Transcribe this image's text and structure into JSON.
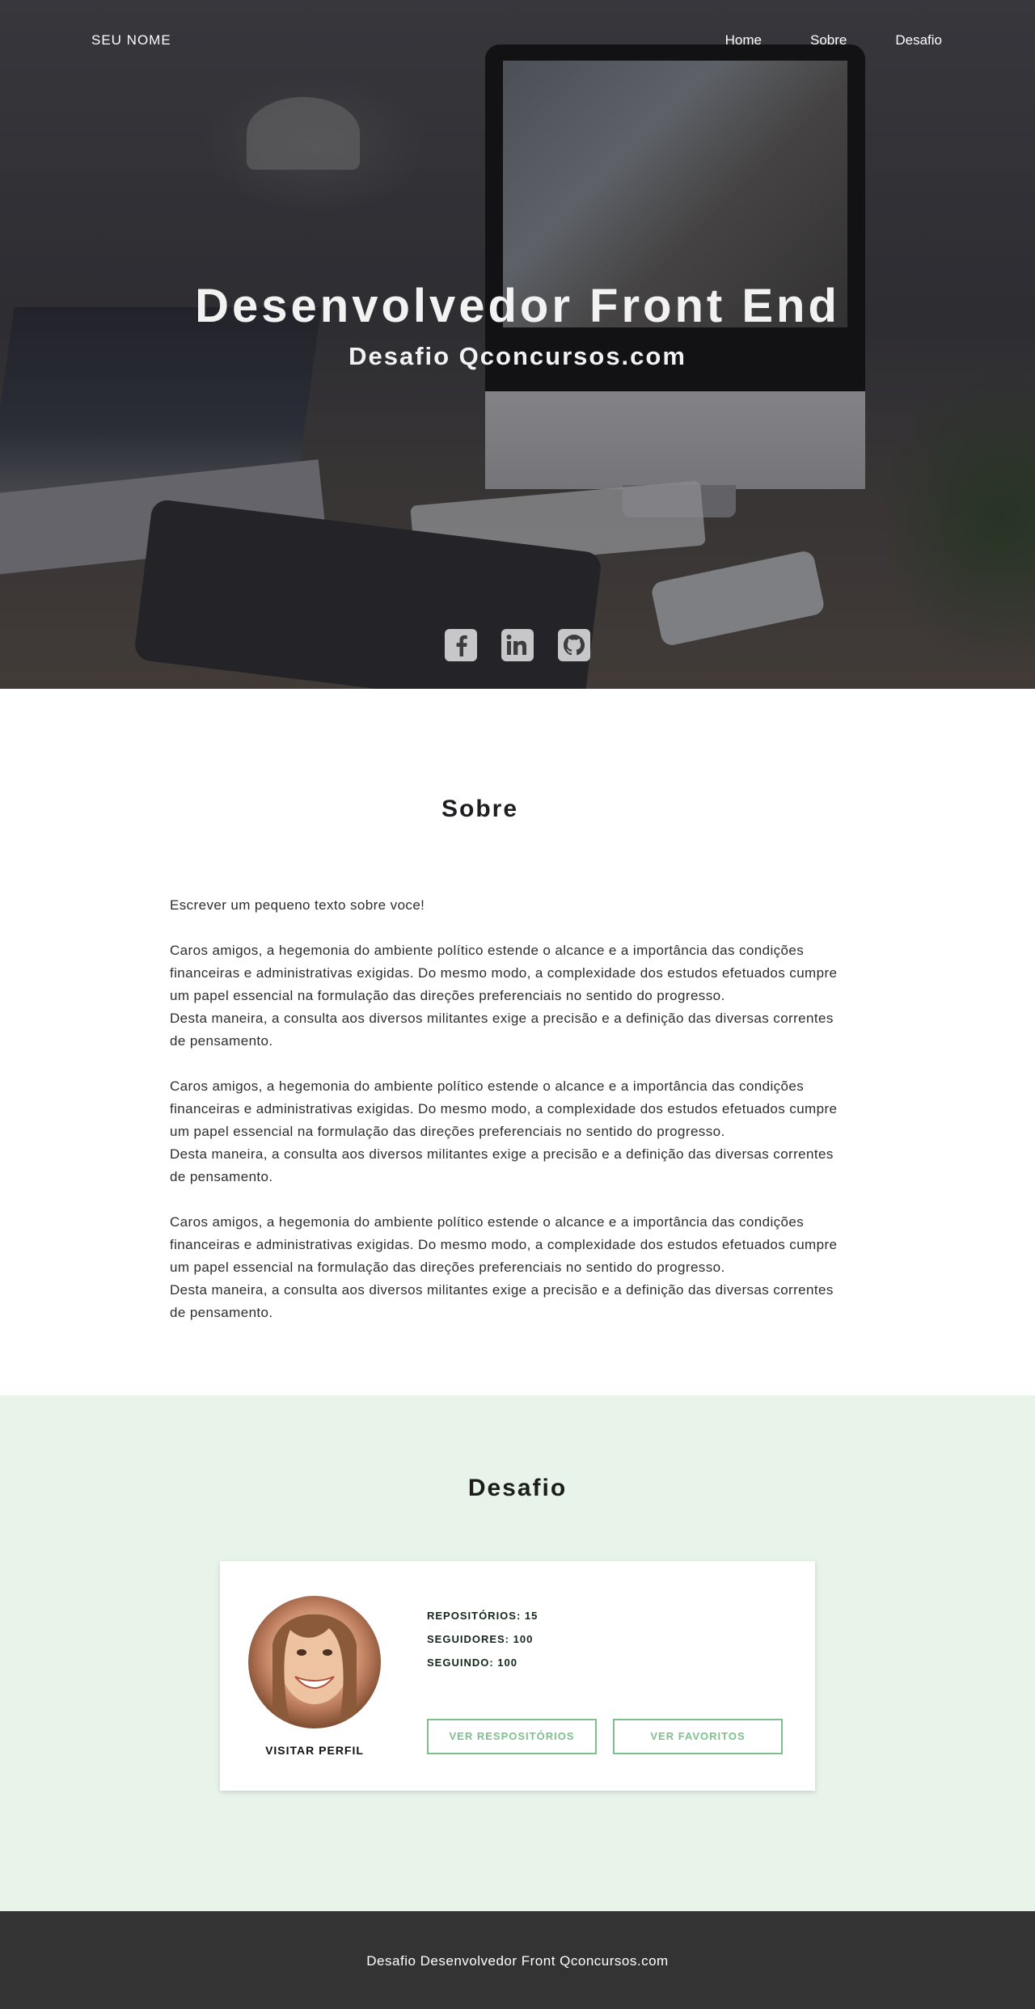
{
  "nav": {
    "brand": "SEU NOME",
    "links": [
      "Home",
      "Sobre",
      "Desafio"
    ]
  },
  "hero": {
    "title": "Desenvolvedor Front End",
    "subtitle": "Desafio Qconcursos.com",
    "social_icons": [
      "facebook-icon",
      "linkedin-icon",
      "github-icon"
    ]
  },
  "sobre": {
    "title": "Sobre",
    "intro": "Escrever um pequeno texto sobre voce!",
    "paragraphs": [
      [
        "Caros amigos, a hegemonia do ambiente político estende o alcance e a importância das condições",
        "financeiras e administrativas exigidas. Do mesmo modo, a complexidade dos estudos efetuados cumpre",
        "um papel essencial na formulação das direções preferenciais no sentido do progresso.",
        "Desta maneira, a consulta aos diversos militantes exige a precisão e a definição das diversas correntes",
        "de pensamento."
      ],
      [
        "Caros amigos, a hegemonia do ambiente político estende o alcance e a importância das condições",
        "financeiras e administrativas exigidas. Do mesmo modo, a complexidade dos estudos efetuados cumpre",
        "um papel essencial na formulação das direções preferenciais no sentido do progresso.",
        "Desta maneira, a consulta aos diversos militantes exige a precisão e a definição das diversas correntes",
        "de pensamento."
      ],
      [
        "Caros amigos, a hegemonia do ambiente político estende o alcance e a importância das condições",
        "financeiras e administrativas exigidas. Do mesmo modo, a complexidade dos estudos efetuados cumpre",
        "um papel essencial na formulação das direções preferenciais no sentido do progresso.",
        "Desta maneira, a consulta aos diversos militantes exige a precisão e a definição das diversas correntes",
        "de pensamento."
      ]
    ]
  },
  "desafio": {
    "title": "Desafio",
    "visit_label": "VISITAR PERFIL",
    "stats": {
      "repos": "REPOSITÓRIOS: 15",
      "followers": "SEGUIDORES: 100",
      "following": "SEGUINDO: 100"
    },
    "buttons": {
      "repos": "VER RESPOSITÓRIOS",
      "favorites": "VER FAVORITOS"
    },
    "accent_color": "#7dc08d",
    "background_color": "#e8f4ea"
  },
  "footer": {
    "text": "Desafio Desenvolvedor Front Qconcursos.com"
  }
}
